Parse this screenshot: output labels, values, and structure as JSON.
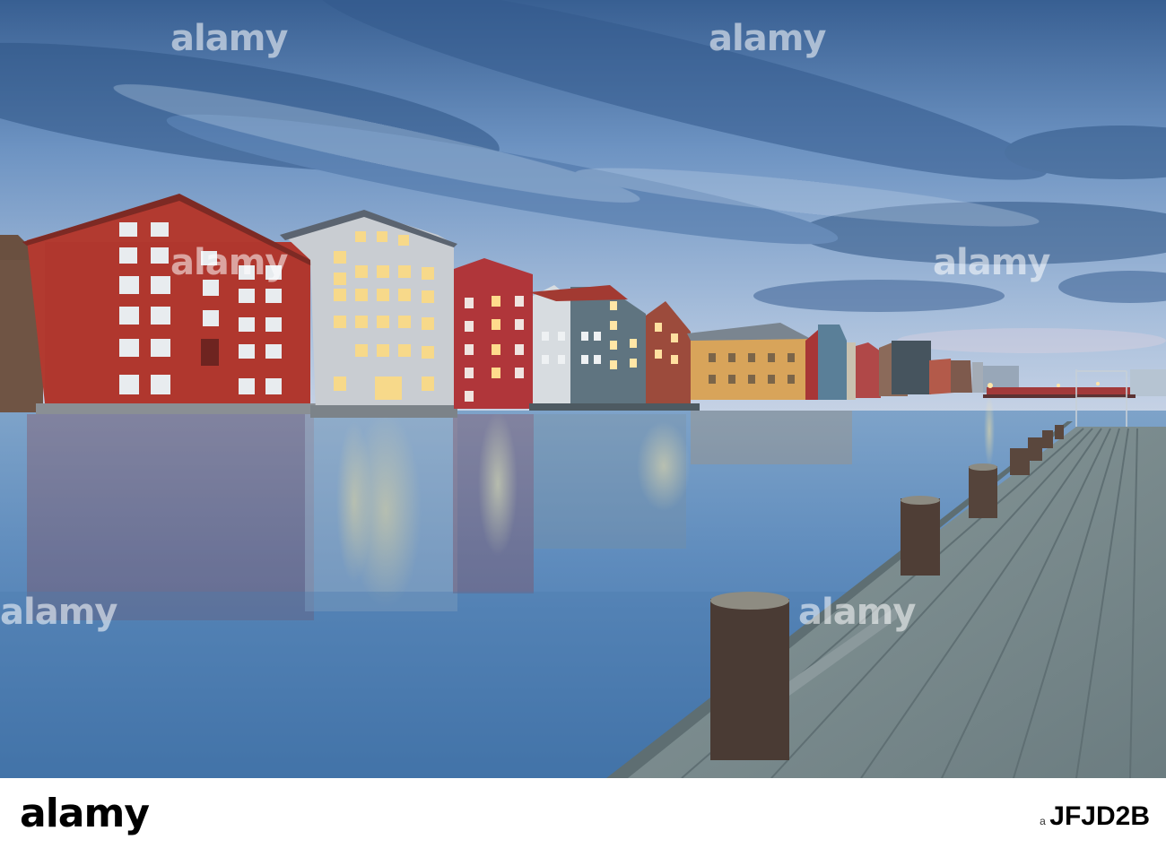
{
  "watermark": {
    "text": "alamy"
  },
  "footer": {
    "logo_text": "alamy",
    "image_id_prefix": "a",
    "image_id": "JFJD2B"
  },
  "palette": {
    "sky_top": "#3f6fa6",
    "sky_mid": "#7fa3cc",
    "sky_low": "#b9cbe0",
    "water": "#5f8fbf",
    "red_warehouse": "#b23a30",
    "white_warehouse": "#c9cdd2",
    "yellow_warehouse": "#d8a45a",
    "deck": "#7f9094"
  }
}
